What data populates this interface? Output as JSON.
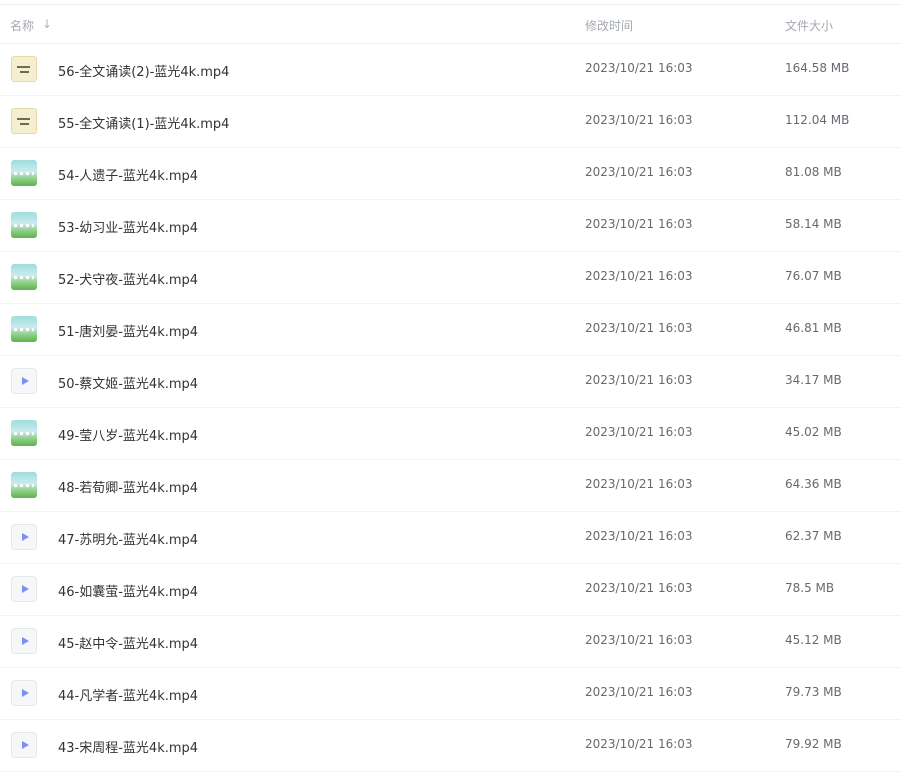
{
  "header": {
    "name_label": "名称",
    "sort_arrow": "↓",
    "date_label": "修改时间",
    "size_label": "文件大小"
  },
  "files": [
    {
      "name": "56-全文诵读(2)-蓝光4k.mp4",
      "date": "2023/10/21 16:03",
      "size": "164.58 MB",
      "thumb": "paper"
    },
    {
      "name": "55-全文诵读(1)-蓝光4k.mp4",
      "date": "2023/10/21 16:03",
      "size": "112.04 MB",
      "thumb": "paper"
    },
    {
      "name": "54-人遗子-蓝光4k.mp4",
      "date": "2023/10/21 16:03",
      "size": "81.08 MB",
      "thumb": "scene"
    },
    {
      "name": "53-幼习业-蓝光4k.mp4",
      "date": "2023/10/21 16:03",
      "size": "58.14 MB",
      "thumb": "scene"
    },
    {
      "name": "52-犬守夜-蓝光4k.mp4",
      "date": "2023/10/21 16:03",
      "size": "76.07 MB",
      "thumb": "scene"
    },
    {
      "name": "51-唐刘晏-蓝光4k.mp4",
      "date": "2023/10/21 16:03",
      "size": "46.81 MB",
      "thumb": "scene"
    },
    {
      "name": "50-蔡文姬-蓝光4k.mp4",
      "date": "2023/10/21 16:03",
      "size": "34.17 MB",
      "thumb": "video"
    },
    {
      "name": "49-莹八岁-蓝光4k.mp4",
      "date": "2023/10/21 16:03",
      "size": "45.02 MB",
      "thumb": "scene"
    },
    {
      "name": "48-若荀卿-蓝光4k.mp4",
      "date": "2023/10/21 16:03",
      "size": "64.36 MB",
      "thumb": "scene"
    },
    {
      "name": "47-苏明允-蓝光4k.mp4",
      "date": "2023/10/21 16:03",
      "size": "62.37 MB",
      "thumb": "video"
    },
    {
      "name": "46-如囊萤-蓝光4k.mp4",
      "date": "2023/10/21 16:03",
      "size": "78.5 MB",
      "thumb": "video"
    },
    {
      "name": "45-赵中令-蓝光4k.mp4",
      "date": "2023/10/21 16:03",
      "size": "45.12 MB",
      "thumb": "video"
    },
    {
      "name": "44-凡学者-蓝光4k.mp4",
      "date": "2023/10/21 16:03",
      "size": "79.73 MB",
      "thumb": "video"
    },
    {
      "name": "43-宋周程-蓝光4k.mp4",
      "date": "2023/10/21 16:03",
      "size": "79.92 MB",
      "thumb": "video"
    }
  ]
}
